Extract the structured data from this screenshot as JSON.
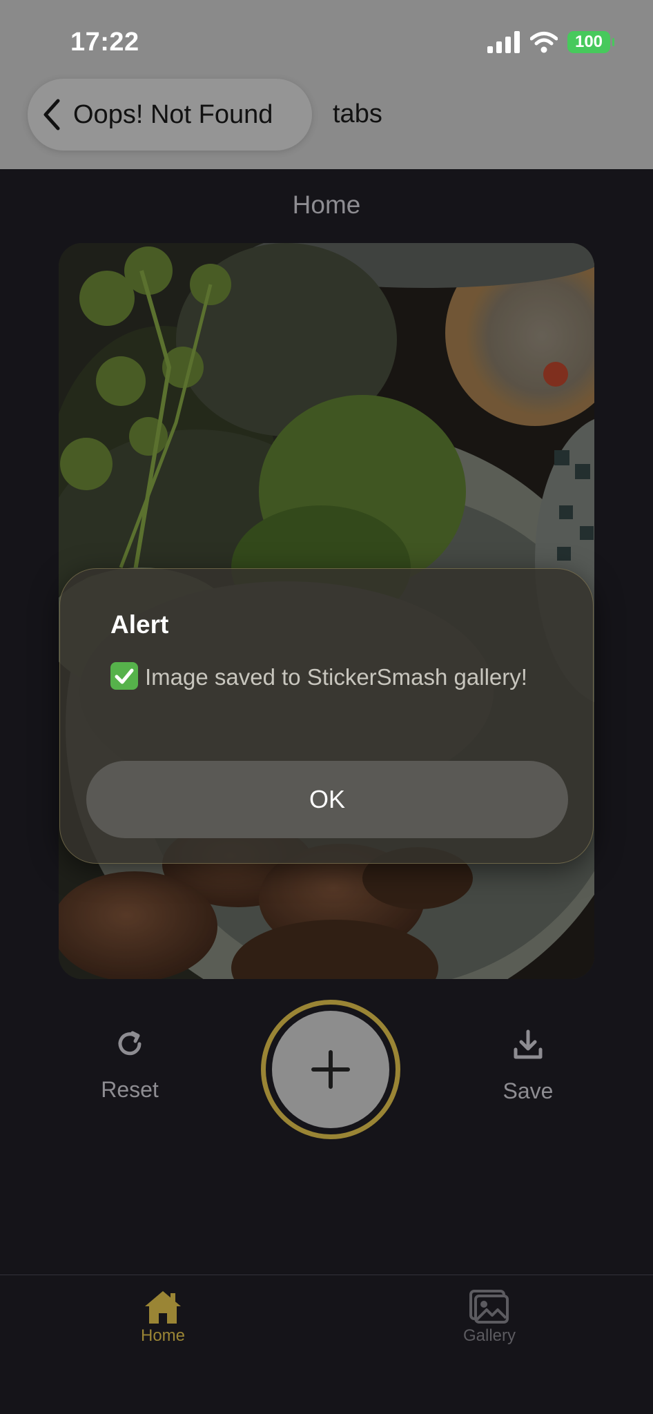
{
  "status_bar": {
    "time": "17:22",
    "battery": "100"
  },
  "nav": {
    "back_label": "Oops! Not Found",
    "title": "tabs"
  },
  "page": {
    "title": "Home"
  },
  "alert": {
    "title": "Alert",
    "message": "Image saved to StickerSmash gallery!",
    "ok_label": "OK"
  },
  "controls": {
    "reset_label": "Reset",
    "save_label": "Save"
  },
  "tabbar": {
    "items": [
      {
        "label": "Home",
        "icon": "home-icon",
        "active": true
      },
      {
        "label": "Gallery",
        "icon": "gallery-icon",
        "active": false
      }
    ]
  },
  "colors": {
    "accent": "#9a8535",
    "background": "#151419",
    "header": "#8a8a8a"
  }
}
